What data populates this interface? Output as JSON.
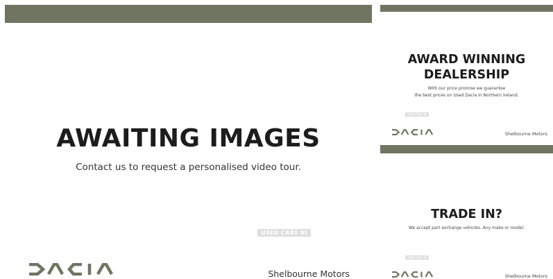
{
  "colors": {
    "accent_bar": "#6f7560",
    "logo": "#6f7560",
    "text": "#1c1c1c"
  },
  "main_panel": {
    "title": "AWAITING IMAGES",
    "subtitle": "Contact us to request a personalised video tour.",
    "watermark": "USED CARS NI",
    "brand_logo": "dacia-logo",
    "dealer": "Shelbourne Motors"
  },
  "award_panel": {
    "title_line1": "AWARD WINNING",
    "title_line2": "DEALERSHIP",
    "body_line1": "With our price promise we guarantee",
    "body_line2": "the best prices on Used Dacia in Northern Ireland.",
    "watermark": "USED CARS NI",
    "brand_logo": "dacia-logo",
    "dealer": "Shelbourne Motors"
  },
  "trade_panel": {
    "title": "TRADE IN?",
    "body": "We accept part exchange vehicles. Any make or model.",
    "watermark": "USED CARS NI",
    "brand_logo": "dacia-logo",
    "dealer": "Shelbourne Motors"
  }
}
